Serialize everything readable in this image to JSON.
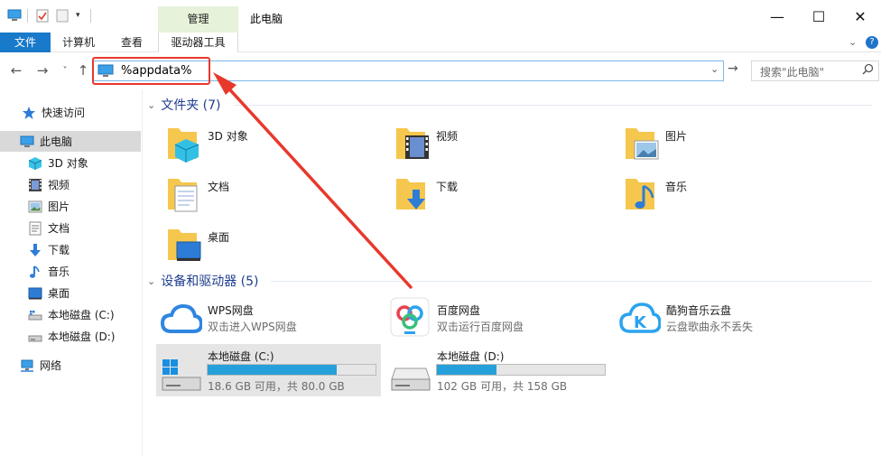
{
  "window": {
    "title": "此电脑",
    "manage_tab": "管理",
    "controls": {
      "minimize": "—",
      "maximize": "☐",
      "close": "✕"
    }
  },
  "ribbon": {
    "file_tab": "文件",
    "tabs": [
      "计算机",
      "查看"
    ],
    "drive_tools_tab": "驱动器工具"
  },
  "address": {
    "value": "%appdata%",
    "search_placeholder": "搜索\"此电脑\""
  },
  "sidebar": {
    "items": [
      {
        "label": "快速访问",
        "icon": "star-icon"
      },
      {
        "label": "此电脑",
        "icon": "computer-icon",
        "selected": true
      },
      {
        "label": "3D 对象",
        "icon": "cube-icon"
      },
      {
        "label": "视频",
        "icon": "video-icon"
      },
      {
        "label": "图片",
        "icon": "picture-icon"
      },
      {
        "label": "文档",
        "icon": "document-icon"
      },
      {
        "label": "下载",
        "icon": "download-icon"
      },
      {
        "label": "音乐",
        "icon": "music-icon"
      },
      {
        "label": "桌面",
        "icon": "desktop-icon"
      },
      {
        "label": "本地磁盘 (C:)",
        "icon": "drive-icon"
      },
      {
        "label": "本地磁盘 (D:)",
        "icon": "drive-icon"
      },
      {
        "label": "网络",
        "icon": "network-icon"
      }
    ]
  },
  "folders_group": {
    "title": "文件夹 (7)",
    "items": [
      {
        "label": "3D 对象",
        "icon": "cube-icon"
      },
      {
        "label": "视频",
        "icon": "video-icon"
      },
      {
        "label": "图片",
        "icon": "picture-icon"
      },
      {
        "label": "文档",
        "icon": "document-icon"
      },
      {
        "label": "下载",
        "icon": "download-icon"
      },
      {
        "label": "音乐",
        "icon": "music-icon"
      },
      {
        "label": "桌面",
        "icon": "desktop-icon"
      }
    ]
  },
  "devices_group": {
    "title": "设备和驱动器 (5)",
    "items": [
      {
        "name": "WPS网盘",
        "sub": "双击进入WPS网盘",
        "icon": "cloud-icon"
      },
      {
        "name": "百度网盘",
        "sub": "双击运行百度网盘",
        "icon": "baidu-netdisk-icon"
      },
      {
        "name": "酷狗音乐云盘",
        "sub": "云盘歌曲永不丢失",
        "icon": "kugou-icon"
      }
    ],
    "drives": [
      {
        "name": "本地磁盘 (C:)",
        "free": "18.6 GB 可用，共 80.0 GB",
        "used_fraction": 0.7675
      },
      {
        "name": "本地磁盘 (D:)",
        "free": "102 GB 可用，共 158 GB",
        "used_fraction": 0.3544
      }
    ]
  },
  "colors": {
    "accent": "#1979ca",
    "group_title": "#1e3d8f",
    "annotation": "#e8382c",
    "bar_fill": "#26a0da",
    "folder": "#f5c74e"
  }
}
